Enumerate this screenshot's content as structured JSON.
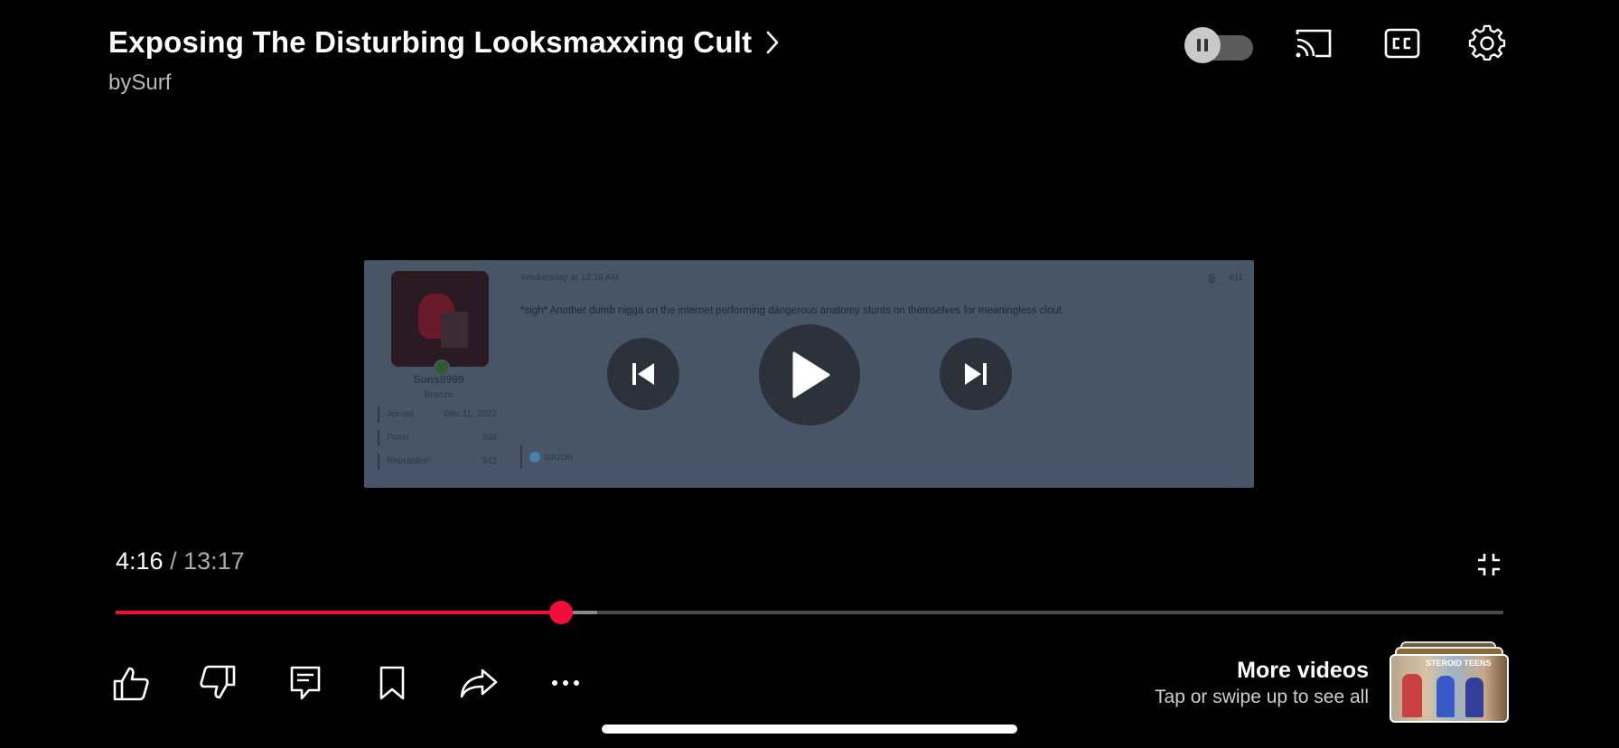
{
  "header": {
    "title": "Exposing The Disturbing Looksmaxxing Cult",
    "channel": "bySurf"
  },
  "video_content": {
    "post_date": "Wednesday at 12:16 AM",
    "post_number": "#11",
    "post_text": "*sigh* Another dumb nigga on the internet performing dangerous anatomy stunts on themselves for meaningless clout",
    "username": "Suns9999",
    "rank": "Bronze",
    "stats": [
      {
        "key": "Joined",
        "value": "Dec 11, 2022"
      },
      {
        "key": "Posts",
        "value": "266"
      },
      {
        "key": "Reputation",
        "value": "342"
      }
    ],
    "reaction_user": "zurzolo"
  },
  "player": {
    "current_time": "4:16",
    "duration": " / 13:17",
    "progress_fraction": 0.3207,
    "buffered_fraction": 0.347,
    "accent_color": "#f20d3c"
  },
  "more_videos": {
    "title": "More videos",
    "subtitle": "Tap or swipe up to see all",
    "thumb_caption": "STEROID TEENS"
  },
  "icons": {
    "top": [
      "autoplay-toggle",
      "cast-icon",
      "captions-icon",
      "settings-gear-icon"
    ],
    "center": [
      "previous-icon",
      "play-icon",
      "next-icon"
    ],
    "bottom": [
      "like-icon",
      "dislike-icon",
      "comments-icon",
      "save-icon",
      "share-icon",
      "more-icon"
    ]
  }
}
